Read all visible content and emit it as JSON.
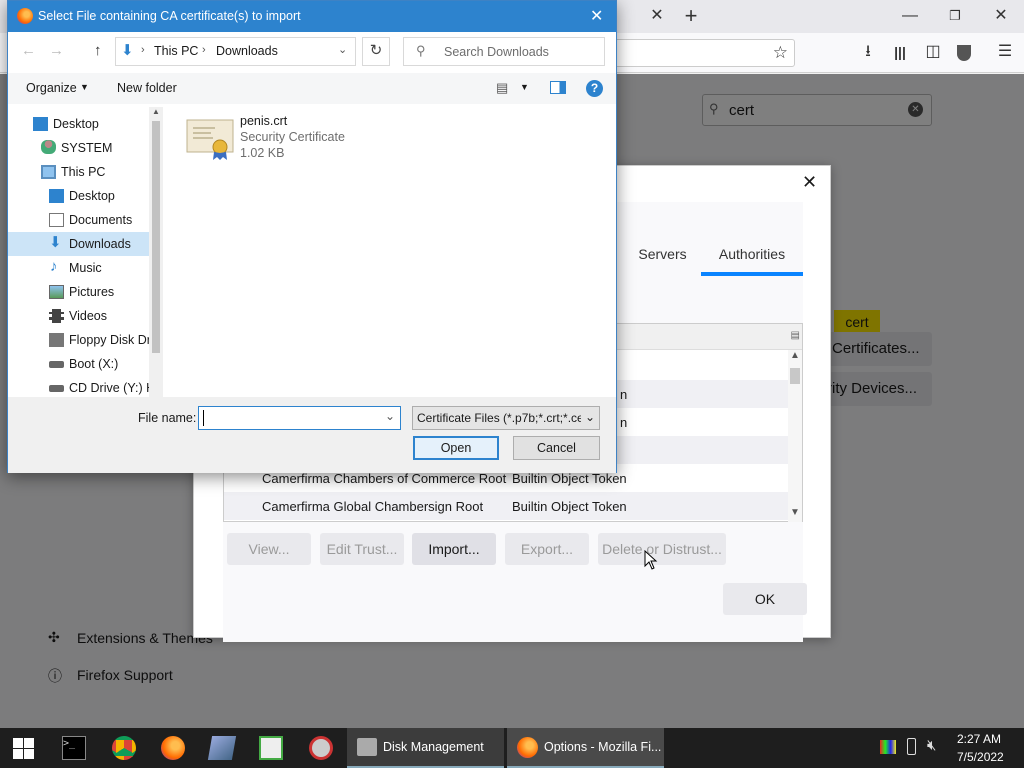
{
  "firefox": {
    "search_value": "cert",
    "highlight_word": "cert",
    "view_certificates_label": "Certificates...",
    "security_devices_label": "rity Devices...",
    "sidebar": {
      "extensions_label": "Extensions & Themes",
      "support_label": "Firefox Support"
    }
  },
  "cert_dialog": {
    "tabs": [
      "Servers",
      "Authorities"
    ],
    "active_tab": "Authorities",
    "rows": [
      {
        "name": "",
        "token": ""
      },
      {
        "name": "",
        "token": "n"
      },
      {
        "name": "",
        "token": "n"
      },
      {
        "name": "",
        "token": ""
      },
      {
        "name": "Camerfirma Chambers of Commerce Root",
        "token": "Builtin Object Token"
      },
      {
        "name": "Camerfirma Global Chambersign Root",
        "token": "Builtin Object Token"
      }
    ],
    "buttons": {
      "view": "View...",
      "edit_trust": "Edit Trust...",
      "import": "Import...",
      "export": "Export...",
      "delete": "Delete or Distrust...",
      "ok": "OK"
    }
  },
  "file_dialog": {
    "title": "Select File containing CA certificate(s) to import",
    "breadcrumb": [
      "This PC",
      "Downloads"
    ],
    "search_placeholder": "Search Downloads",
    "organize_label": "Organize",
    "new_folder_label": "New folder",
    "tree": [
      {
        "label": "Desktop",
        "icon": "desktop-icon"
      },
      {
        "label": "SYSTEM",
        "icon": "user-icon"
      },
      {
        "label": "This PC",
        "icon": "pc-icon"
      },
      {
        "label": "Desktop",
        "icon": "desktop-icon"
      },
      {
        "label": "Documents",
        "icon": "documents-icon"
      },
      {
        "label": "Downloads",
        "icon": "downloads-icon"
      },
      {
        "label": "Music",
        "icon": "music-icon"
      },
      {
        "label": "Pictures",
        "icon": "pictures-icon"
      },
      {
        "label": "Videos",
        "icon": "videos-icon"
      },
      {
        "label": "Floppy Disk Dri",
        "icon": "floppy-icon"
      },
      {
        "label": "Boot (X:)",
        "icon": "drive-icon"
      },
      {
        "label": "CD Drive (Y:) H",
        "icon": "cd-drive-icon"
      }
    ],
    "selected_tree_index": 5,
    "file": {
      "name": "penis.crt",
      "type": "Security Certificate",
      "size": "1.02 KB"
    },
    "filename_label": "File name:",
    "filename_value": "",
    "filter_value": "Certificate Files (*.p7b;*.crt;*.ce",
    "open_label": "Open",
    "cancel_label": "Cancel"
  },
  "taskbar": {
    "tasks": [
      {
        "label": "Disk Management"
      },
      {
        "label": "Options - Mozilla Fi..."
      }
    ],
    "time": "2:27 AM",
    "date": "7/5/2022"
  },
  "colors": {
    "accent": "#0a84ff",
    "title_bar": "#2d83ce",
    "highlight": "#ffe900",
    "taskbar": "#1e1e1e"
  }
}
